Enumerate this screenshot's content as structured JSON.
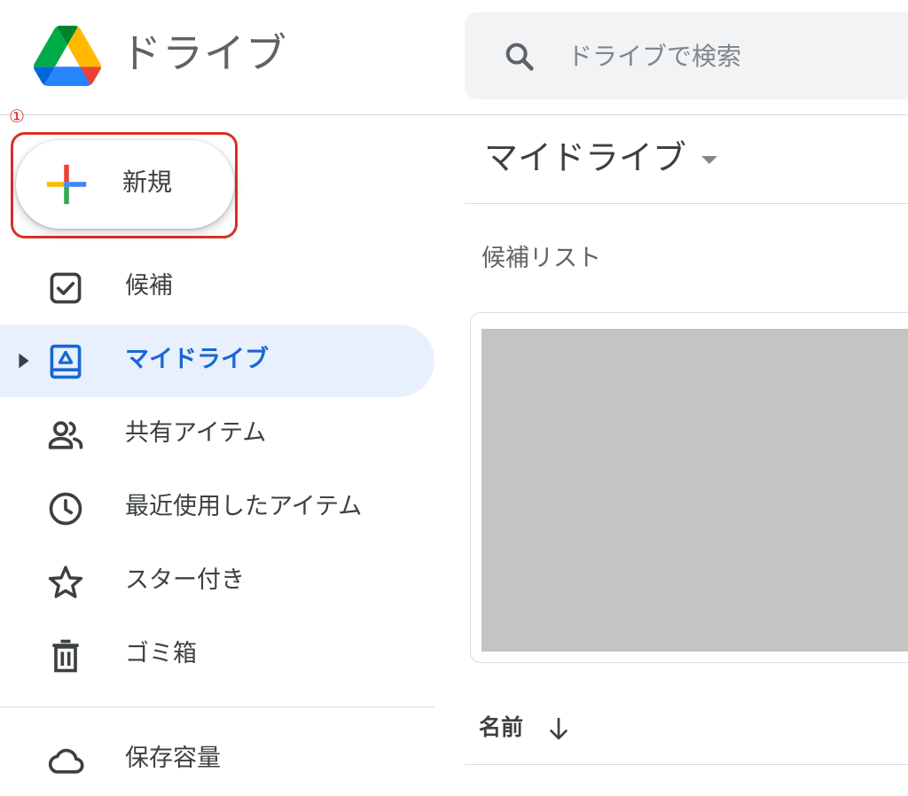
{
  "app": {
    "title": "ドライブ",
    "logo_icon": "google-drive-logo"
  },
  "search": {
    "placeholder": "ドライブで検索",
    "icon": "search-icon"
  },
  "annotation": {
    "step_marker": "①",
    "highlight_color": "#d93025"
  },
  "new_button": {
    "label": "新規",
    "icon": "multicolor-plus-icon"
  },
  "sidebar": {
    "items": [
      {
        "label": "候補",
        "icon": "suggested-checkbox-icon",
        "active": false
      },
      {
        "label": "マイドライブ",
        "icon": "my-drive-icon",
        "active": true
      },
      {
        "label": "共有アイテム",
        "icon": "shared-people-icon",
        "active": false
      },
      {
        "label": "最近使用したアイテム",
        "icon": "recent-clock-icon",
        "active": false
      },
      {
        "label": "スター付き",
        "icon": "star-icon",
        "active": false
      },
      {
        "label": "ゴミ箱",
        "icon": "trash-icon",
        "active": false
      },
      {
        "label": "保存容量",
        "icon": "cloud-storage-icon",
        "active": false
      }
    ]
  },
  "main": {
    "title": "マイドライブ",
    "suggested_section_label": "候補リスト",
    "sort_column_label": "名前",
    "sort_direction": "descending"
  },
  "colors": {
    "accent": "#1967d2",
    "active_bg": "#e8f0fe",
    "search_bg": "#f1f3f4",
    "text_secondary": "#5f6368",
    "drive_green": "#0f9d58",
    "drive_yellow": "#fbbc04",
    "drive_blue": "#4285f4",
    "drive_red": "#ea4335"
  }
}
